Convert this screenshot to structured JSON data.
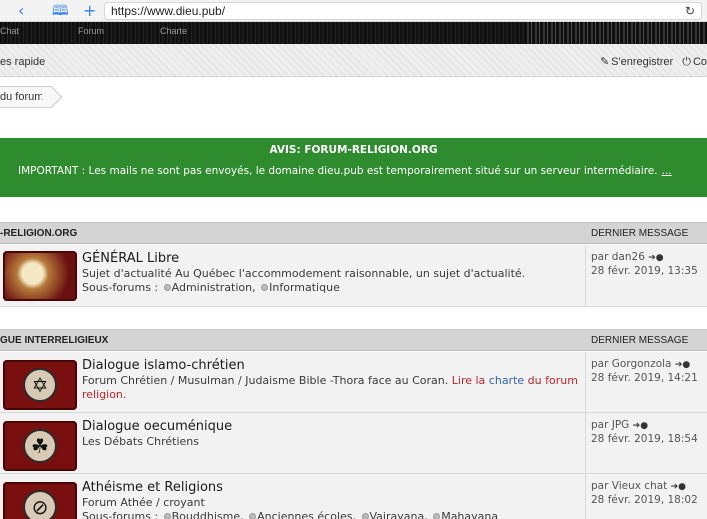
{
  "browser": {
    "back_icon": "chevron-left-icon",
    "bookmarks_icon": "book-icon",
    "newtab_icon": "plus-icon",
    "url": "https://www.dieu.pub/",
    "reload_icon": "reload-icon"
  },
  "header_nav": [
    "Chat",
    "Forum",
    "Charte"
  ],
  "subnav": {
    "left": "es rapide",
    "register_label": "S'enregistrer",
    "login_label": "Co"
  },
  "breadcrumb": "du forum",
  "notice": {
    "title": "AVIS: FORUM-RELIGION.ORG",
    "message": "IMPORTANT : Les mails ne sont pas envoyés, le domaine dieu.pub est temporairement situé sur un serveur intermédiaire.",
    "more": "..."
  },
  "categories": [
    {
      "name": "-RELIGION.ORG",
      "last_header": "DERNIER MESSAGE",
      "forums": [
        {
          "title": "GÉNÉRAL Libre",
          "desc_lead": "Sujet d'actualité",
          "desc_rest": " Au Québec l'accommodement raisonnable, un sujet d'actualité.",
          "subs_label": "Sous-forums :",
          "subs": [
            "Administration,",
            "Informatique"
          ],
          "last_by": "par dan26",
          "last_date": "28 févr. 2019, 13:35"
        }
      ]
    },
    {
      "name": "GUE INTERRELIGIEUX",
      "last_header": "DERNIER MESSAGE",
      "forums": [
        {
          "title": "Dialogue islamo-chrétien",
          "desc_a": "Forum Chrétien / Musulman / Judaisme Bible -Thora face au Coran.",
          "desc_red1": "Lire la",
          "desc_blue": "charte",
          "desc_red2": "du forum religion.",
          "last_by": "par Gorgonzola",
          "last_date": "28 févr. 2019, 14:21"
        },
        {
          "title": "Dialogue oecuménique",
          "desc": "Les Débats Chrétiens",
          "last_by": "par JPG",
          "last_date": "28 févr. 2019, 18:54"
        },
        {
          "title": "Athéisme et Religions",
          "desc": "Forum Athée / croyant",
          "subs_label": "Sous-forums :",
          "subs": [
            "Bouddhisme,",
            "Anciennes écoles,",
            "Vajrayana,",
            "Mahayana"
          ],
          "last_by": "par Vieux chat",
          "last_date": "28 févr. 2019, 18:02"
        }
      ]
    }
  ]
}
